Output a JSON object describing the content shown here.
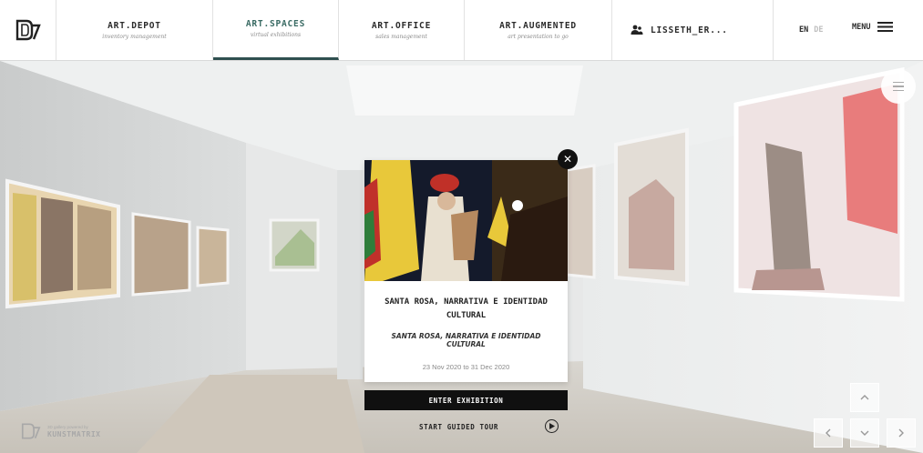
{
  "header": {
    "logo_icon": "kunstmatrix-logo-icon",
    "nav": [
      {
        "label": "ART.DEPOT",
        "sub": "inventory management",
        "active": false
      },
      {
        "label": "ART.SPACES",
        "sub": "virtual exhibitions",
        "active": true
      },
      {
        "label": "ART.OFFICE",
        "sub": "sales management",
        "active": false
      },
      {
        "label": "ART.AUGMENTED",
        "sub": "art presentation to go",
        "active": false
      }
    ],
    "user": {
      "icon": "user-group-icon",
      "name": "LISSETH_ER..."
    },
    "lang": {
      "en": "EN",
      "de": "DE"
    },
    "menu_label": "MENU",
    "accent_color": "#2f4f4f"
  },
  "popup": {
    "title": "SANTA ROSA, NARRATIVA E IDENTIDAD CULTURAL",
    "subtitle": "SANTA ROSA, NARRATIVA E IDENTIDAD CULTURAL",
    "dates": "23 Nov 2020 to 31 Dec 2020",
    "close_icon": "close-icon",
    "enter_label": "ENTER EXHIBITION",
    "tour_label": "START GUIDED TOUR",
    "tour_icon": "play-circle-icon"
  },
  "footer": {
    "brand_small": "3D gallery powered by",
    "brand_name": "KUNSTMATRIX"
  },
  "controls": {
    "scene_menu_icon": "hamburger-icon",
    "up_icon": "chevron-up-icon",
    "left_icon": "chevron-left-icon",
    "down_icon": "chevron-down-icon",
    "right_icon": "chevron-right-icon"
  }
}
